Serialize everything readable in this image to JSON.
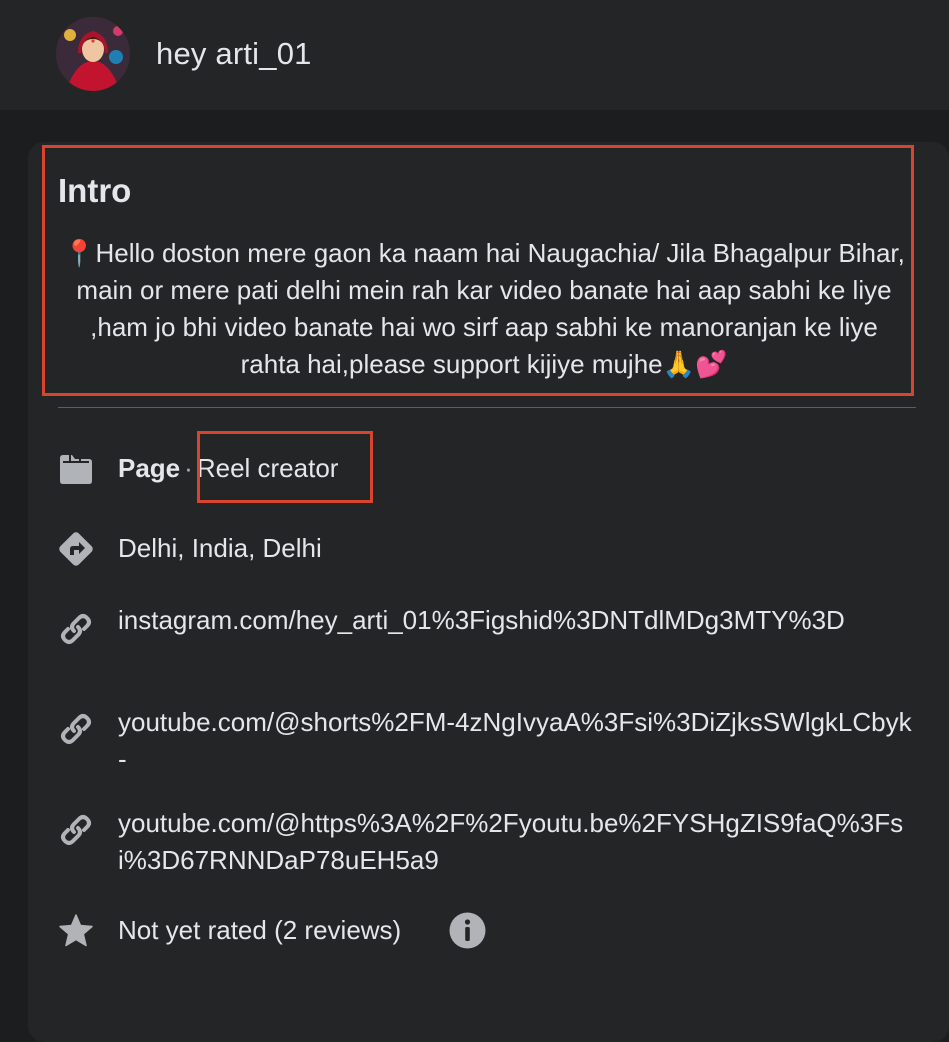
{
  "header": {
    "profile_name": "hey arti_01"
  },
  "intro": {
    "title": "Intro",
    "pin_emoji": "📍",
    "text": "Hello doston mere gaon ka naam hai Naugachia/ Jila Bhagalpur Bihar, main or mere pati delhi mein rah kar video banate hai aap sabhi ke liye ,ham jo bhi video banate hai wo sirf aap sabhi ke manoranjan ke liye rahta hai,please support kijiye mujhe",
    "end_emoji": "🙏💕"
  },
  "details": {
    "category_label": "Page",
    "category_separator": "·",
    "category_value": "Reel creator",
    "location": "Delhi, India, Delhi",
    "links": [
      "instagram.com/hey_arti_01%3Figshid%3DNTdlMDg3MTY%3D",
      "youtube.com/@shorts%2FM-4zNgIvyaA%3Fsi%3DiZjksSWlgkLCbyk-",
      "youtube.com/@https%3A%2F%2Fyoutu.be%2FYSHgZIS9faQ%3Fsi%3D67RNNDaP78uEH5a9"
    ],
    "rating": "Not yet rated (2 reviews)"
  },
  "icons": {
    "category": "page-icon",
    "location": "directions-icon",
    "link": "link-icon",
    "rating": "star-icon",
    "info": "info-icon"
  },
  "colors": {
    "highlight_border": "#d8452f",
    "background": "#1c1d1f",
    "card": "#242526",
    "text": "#e4e6eb",
    "icon": "#b0b3b8"
  }
}
